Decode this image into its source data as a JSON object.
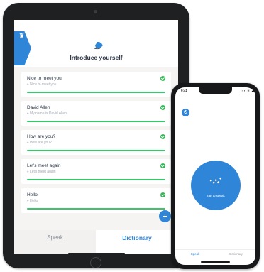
{
  "tablet": {
    "header": {
      "title": "Introduce yourself",
      "left_icon": "puzzle-icon",
      "hand_icon": "waving-hand-icon"
    },
    "phrases": [
      {
        "phrase": "Nice to meet you",
        "translation": "♦ Nice to meet you",
        "done": true
      },
      {
        "phrase": "David Allen",
        "translation": "♦ My name is David Allen",
        "done": true
      },
      {
        "phrase": "How are you?",
        "translation": "♦ How are you?",
        "done": true
      },
      {
        "phrase": "Let's meet again",
        "translation": "♦ Let's meet again",
        "done": true
      },
      {
        "phrase": "Hello",
        "translation": "♦ Hello",
        "done": true
      }
    ],
    "add_button": "+",
    "tabs": {
      "speak": "Speak",
      "dictionary": "Dictionary"
    }
  },
  "phone": {
    "time": "9:41",
    "status": "▪▪▪ ≋ ▬",
    "settings_icon": "gear-icon",
    "mic_label": "Tap to speak",
    "tabs": {
      "speak": "Speak",
      "dictionary": "Dictionary"
    }
  },
  "colors": {
    "accent": "#2f86d8",
    "success": "#34b556",
    "progress": "#39c56a",
    "text": "#2d3848"
  }
}
